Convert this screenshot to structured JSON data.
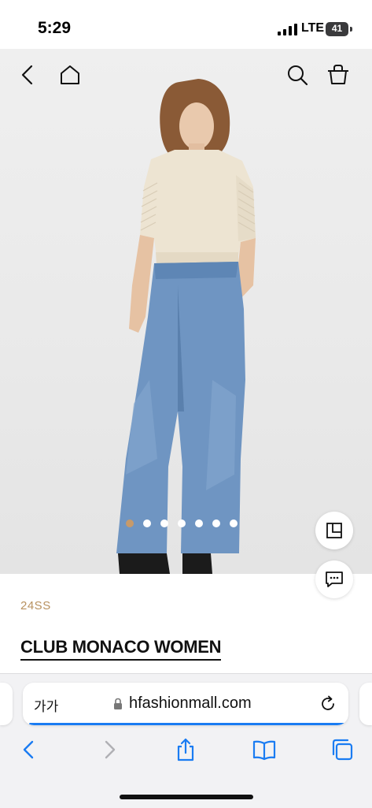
{
  "status_bar": {
    "time": "5:29",
    "network": "LTE",
    "battery": "41"
  },
  "product_nav": {
    "back_icon": "chevron-left-icon",
    "home_icon": "home-icon",
    "search_icon": "search-icon",
    "cart_icon": "shopping-bag-icon"
  },
  "gallery": {
    "image_count": 7,
    "active_index": 0,
    "active_color": "#c79a6a"
  },
  "product": {
    "season": "24SS",
    "brand": "CLUB MONACO WOMEN"
  },
  "browser": {
    "text_size_label": "가가",
    "url": "hfashionmall.com",
    "progress_color": "#1a7cf2"
  },
  "colors": {
    "accent_blue": "#1a7cf2",
    "season_gold": "#b8915f"
  }
}
